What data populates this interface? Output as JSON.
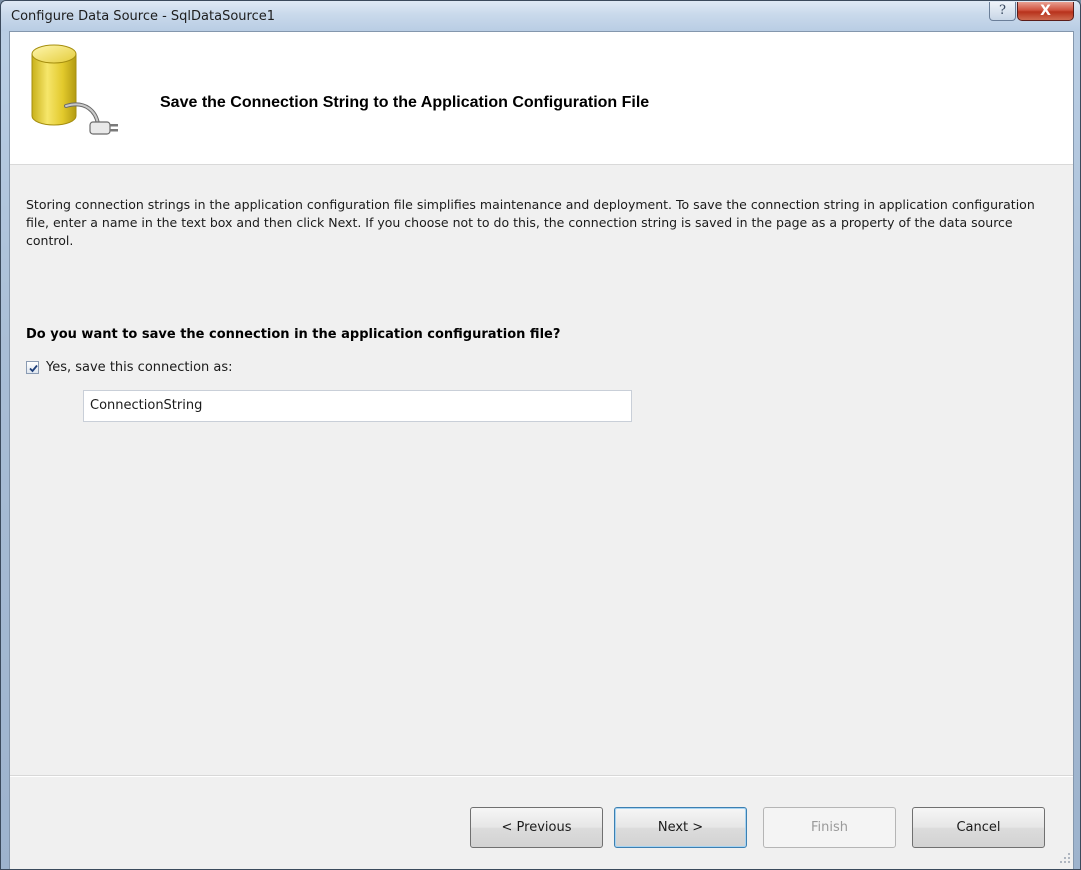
{
  "window": {
    "title": "Configure Data Source - SqlDataSource1",
    "help_label": "?",
    "close_label": "X"
  },
  "header": {
    "title": "Save the Connection String to the Application Configuration File",
    "icon": "database-plug-icon"
  },
  "body": {
    "description": "Storing connection strings in the application configuration file simplifies maintenance and deployment. To save the connection string in application configuration file, enter a name in the text box and then click Next. If you choose not to do this, the connection string is saved in the page as a property of the data source control.",
    "question": "Do you want to save the connection in the application configuration file?",
    "save_checkbox": {
      "label": "Yes, save this connection as:",
      "checked": true
    },
    "connection_name": "ConnectionString"
  },
  "buttons": {
    "previous": "< Previous",
    "next": "Next >",
    "finish": "Finish",
    "cancel": "Cancel"
  },
  "colors": {
    "accent": "#3c7fb1",
    "close": "#c7432b",
    "icon_yellow": "#e8d132"
  }
}
